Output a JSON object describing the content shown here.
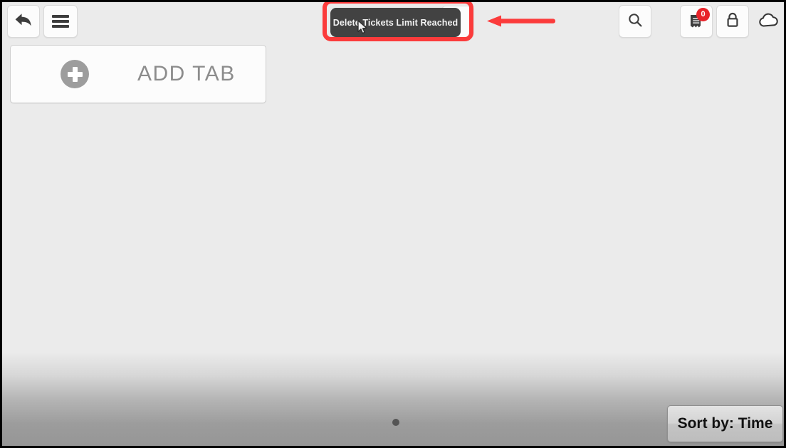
{
  "window": {
    "background": "#ebebeb",
    "border_color": "#000000"
  },
  "toolbar": {
    "back_icon": "back-arrow-icon",
    "menu_icon": "hamburger-menu-icon",
    "search_icon": "search-icon",
    "tickets_icon": "tickets-receipt-icon",
    "tickets_badge_count": "0",
    "tickets_badge_color": "#e8232a",
    "lock_icon": "lock-icon",
    "cloud_icon": "cloud-icon"
  },
  "tabs": {
    "add_tab_label": "ADD TAB",
    "add_tab_icon": "plus-circle-icon"
  },
  "toast": {
    "message": "Delete Tickets Limit Reached",
    "background": "#424242",
    "text_color": "#f2f2f2"
  },
  "annotation": {
    "highlight_color": "#fb3b3b",
    "box_label": "highlight-box-around-toast",
    "arrow_label": "pointer-arrow-left"
  },
  "cursor": {
    "label": "mouse-cursor"
  },
  "footer": {
    "page_indicator_dots": 1,
    "sort_button_label": "Sort by: Time"
  }
}
